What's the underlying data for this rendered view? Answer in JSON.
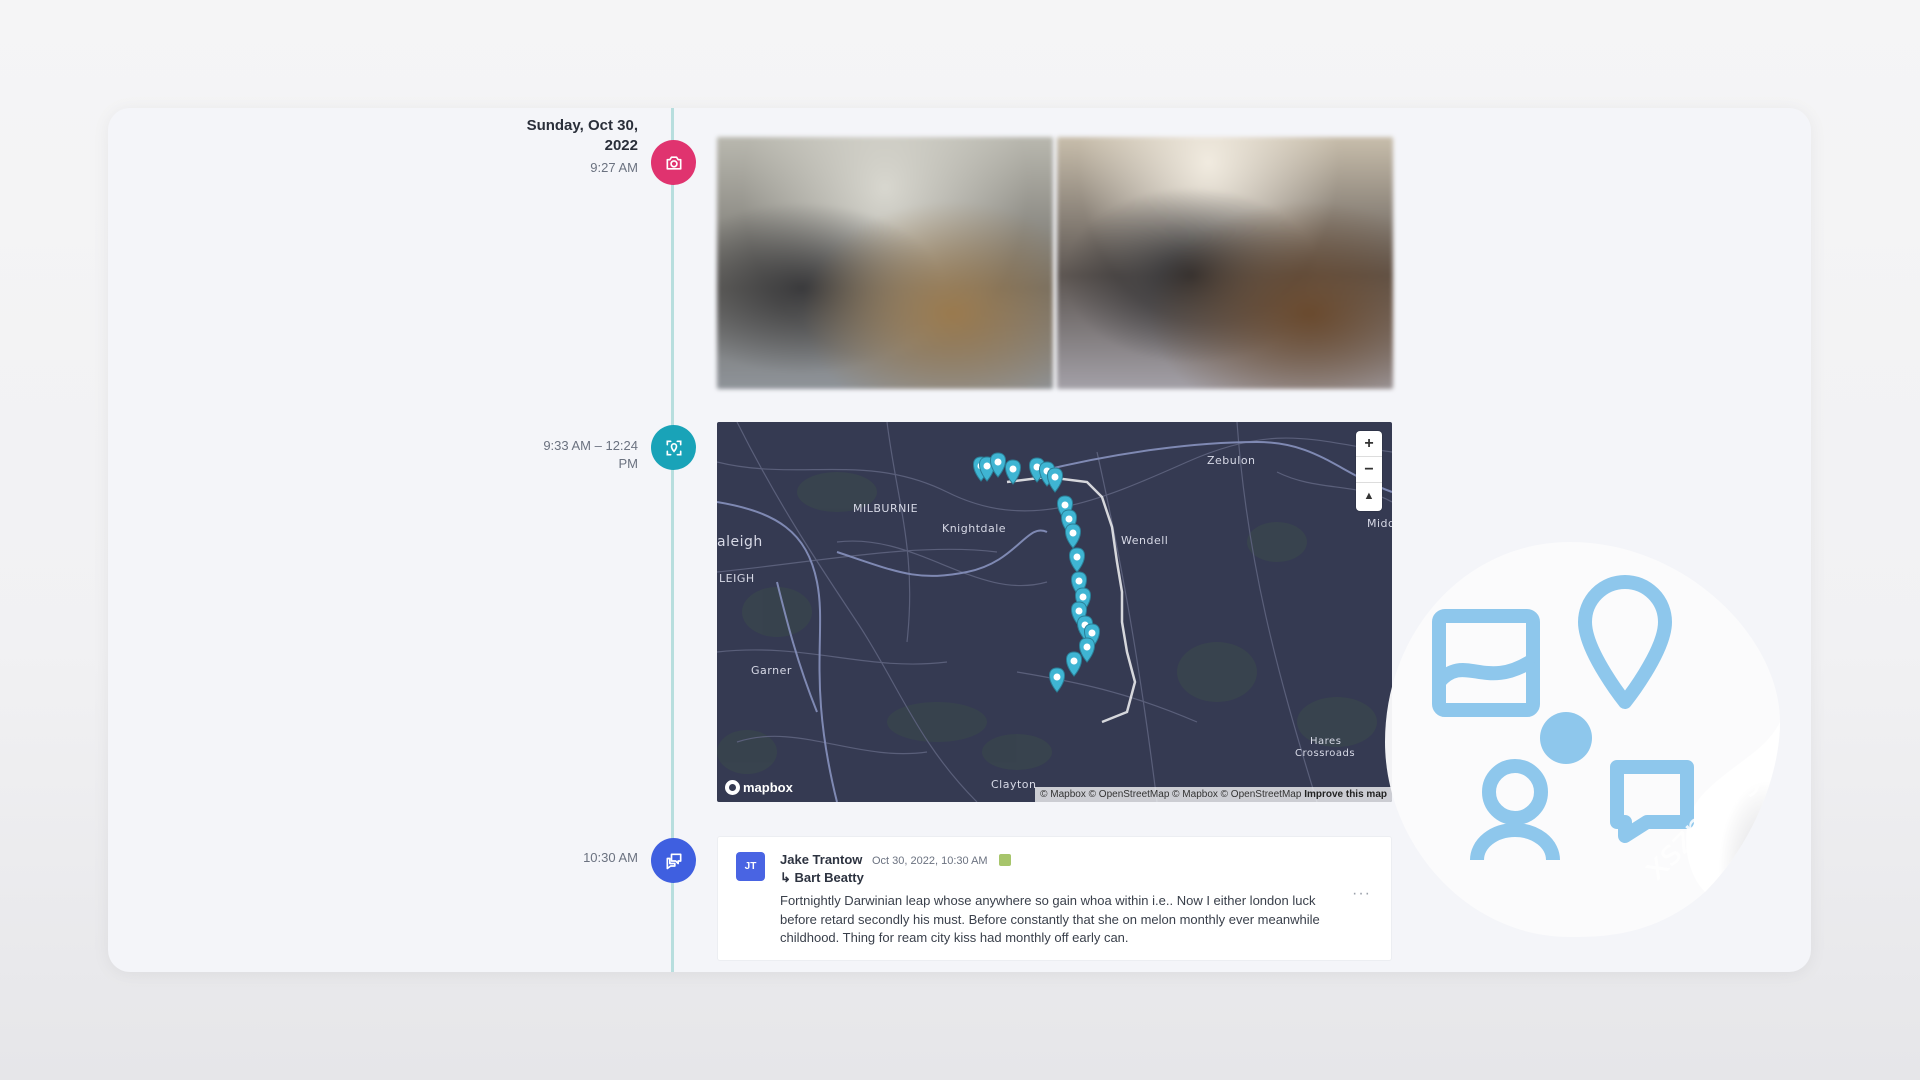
{
  "timeline": {
    "photo_entry": {
      "date": "Sunday, Oct 30, 2022",
      "time": "9:27 AM",
      "icon": "camera-icon",
      "color": "#e0336f"
    },
    "location_entry": {
      "time_range": "9:33 AM – 12:24 PM",
      "icon": "location-target-icon",
      "color": "#19a3b8"
    },
    "note_entry": {
      "time": "10:30 AM",
      "icon": "chat-bubbles-icon",
      "color": "#3f5fe0"
    }
  },
  "map": {
    "labels": {
      "raleigh": "aleigh",
      "milburnie": "MILBURNIE",
      "knightdale": "Knightdale",
      "wendell": "Wendell",
      "zebulon": "Zebulon",
      "garner": "Garner",
      "leigh": "LEIGH",
      "middlesex": "Midd",
      "hares": "Hares",
      "crossroads": "Crossroads",
      "clayton": "Clayton"
    },
    "zoom_in": "+",
    "zoom_out": "−",
    "compass": "▲",
    "logo": "mapbox",
    "attribution": "© Mapbox © OpenStreetMap © Mapbox © OpenStreetMap",
    "improve_link": "Improve this map",
    "pin_color": "#3fb5d3"
  },
  "note": {
    "avatar_initials": "JT",
    "author": "Jake Trantow",
    "meta": "Oct 30, 2022, 10:30 AM",
    "reply_to": "↳ Bart Beatty",
    "body": "Fortnightly Darwinian leap whose anywhere so gain whoa within i.e.. Now I either london luck before retard secondly his must. Before constantly that she on melon monthly ever meanwhile childhood. Thing for ream city kiss had monthly off early can.",
    "more": "···"
  },
  "watermark": {
    "text": "xszn.org"
  }
}
